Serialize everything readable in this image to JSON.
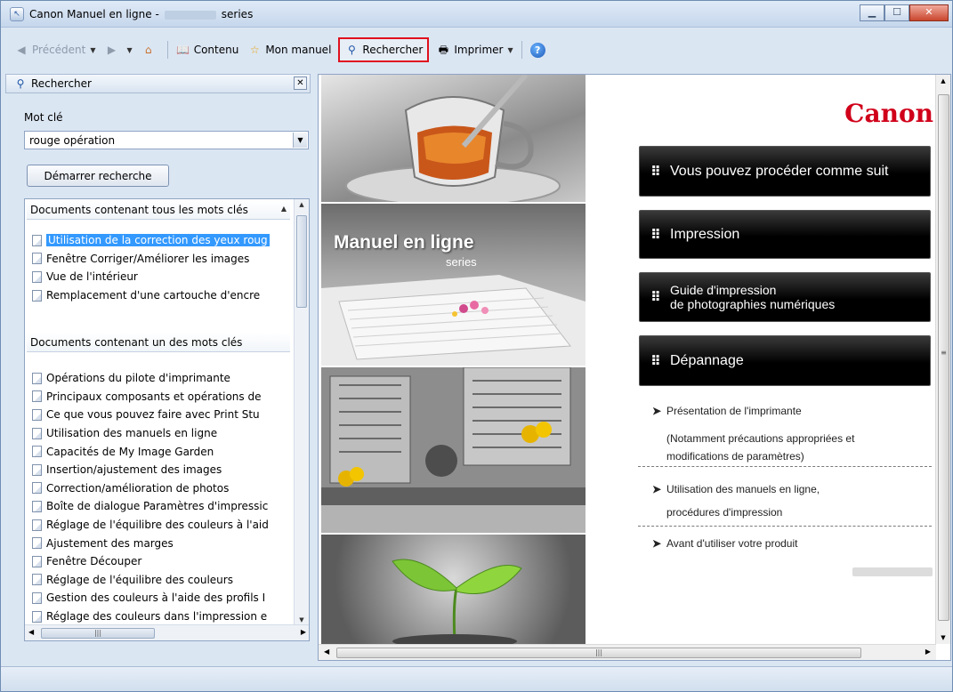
{
  "window": {
    "title_prefix": "Canon Manuel en ligne -",
    "title_suffix": "series"
  },
  "toolbar": {
    "back_label": "Précédent",
    "contents_label": "Contenu",
    "my_manual_label": "Mon manuel",
    "search_label": "Rechercher",
    "print_label": "Imprimer"
  },
  "left_pane": {
    "header": "Rechercher",
    "keyword_label": "Mot clé",
    "keyword_value": "rouge opération",
    "start_button": "Démarrer recherche",
    "all_keywords_header": "Documents contenant tous les mots clés",
    "all_keywords_docs": [
      "Utilisation de la correction des yeux roug",
      "Fenêtre Corriger/Améliorer les images",
      "Vue de l'intérieur",
      "Remplacement d'une cartouche d'encre"
    ],
    "any_keyword_header": "Documents contenant un des mots clés",
    "any_keyword_docs": [
      "Opérations du pilote d'imprimante",
      "Principaux composants et opérations de",
      "Ce que vous pouvez faire avec Print Stu",
      "Utilisation des manuels en ligne",
      "Capacités de My Image Garden",
      "Insertion/ajustement des images",
      "Correction/amélioration de photos",
      "Boîte de dialogue Paramètres d'impressic",
      "Réglage de l'équilibre des couleurs à l'aid",
      "Ajustement des marges",
      "Fenêtre Découper",
      "Réglage de l'équilibre des couleurs",
      "Gestion des couleurs à l'aide des profils I",
      "Réglage des couleurs dans l'impression e"
    ]
  },
  "right_pane": {
    "logo": "Canon",
    "cover_title": "Manuel en ligne",
    "cover_subtitle": "series",
    "menu": [
      "Vous pouvez procéder comme suit",
      "Impression",
      "Guide d'impression",
      "de photographies numériques",
      "Dépannage"
    ],
    "links": {
      "intro": "Présentation de l'imprimante",
      "intro_note_1": "(Notamment précautions appropriées et",
      "intro_note_2": "modifications de paramètres)",
      "usage_1": "Utilisation des manuels en ligne,",
      "usage_2": "procédures d'impression",
      "before": "Avant d'utiliser votre produit"
    }
  },
  "colors": {
    "highlight_box": "#e0101e",
    "canon_red": "#d0001a",
    "selection": "#3399ff"
  }
}
